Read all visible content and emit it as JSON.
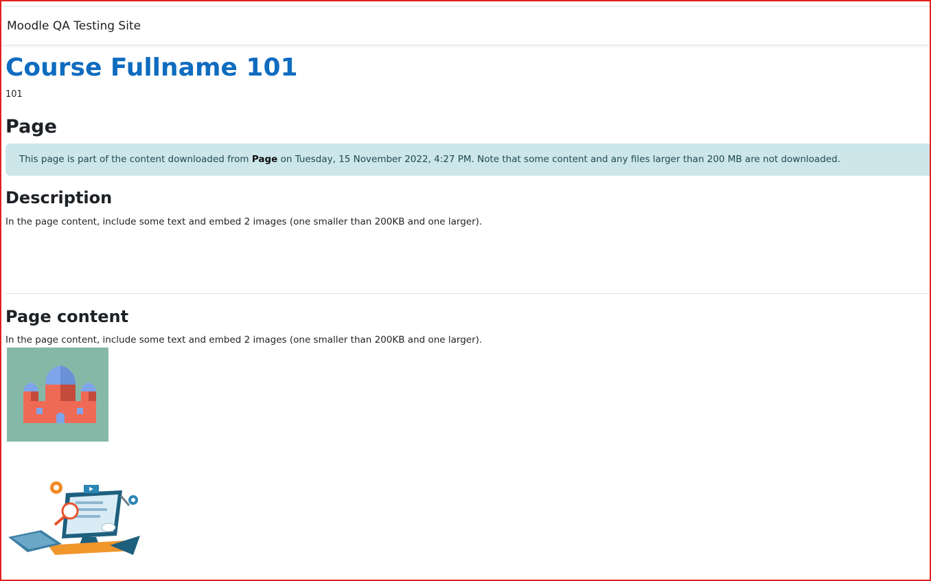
{
  "header": {
    "site_name": "Moodle QA Testing Site"
  },
  "course": {
    "fullname": "Course Fullname 101",
    "shortname": "101"
  },
  "page_heading": "Page",
  "notice": {
    "before": "This page is part of the content downloaded from ",
    "bold": "Page",
    "after": " on Tuesday, 15 November 2022, 4:27 PM. Note that some content and any files larger than 200 MB are not downloaded."
  },
  "description": {
    "heading": "Description",
    "text": "In the page content, include some text and embed 2 images (one smaller than 200KB and one larger)."
  },
  "page_content": {
    "heading": "Page content",
    "text": "In the page content, include some text and embed 2 images (one smaller than 200KB and one larger).",
    "images": [
      {
        "icon": "castle-illustration"
      },
      {
        "icon": "computer-workstation-illustration"
      }
    ]
  },
  "colors": {
    "accent": "#0f6cbf",
    "alert_bg": "#cce6ea",
    "frame": "#e02020"
  }
}
